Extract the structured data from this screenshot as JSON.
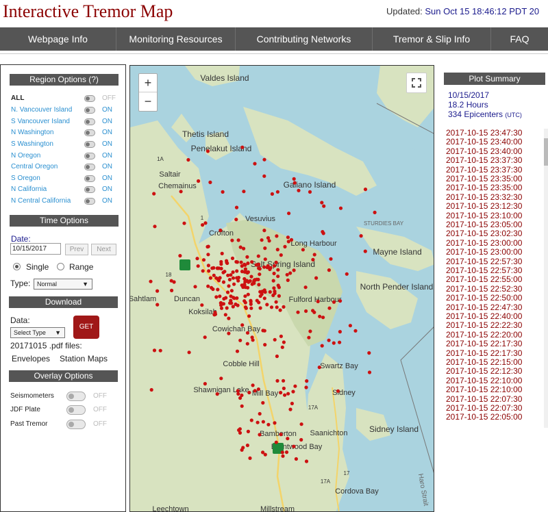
{
  "header": {
    "title": "Interactive Tremor Map",
    "updated_label": "Updated:",
    "updated_value": "Sun Oct 15 18:46:12 PDT 20"
  },
  "nav": [
    "Webpage Info",
    "Monitoring Resources",
    "Contributing Networks",
    "Tremor & Slip Info",
    "FAQ"
  ],
  "region": {
    "heading": "Region Options (?)",
    "items": [
      {
        "name": "ALL",
        "state": "OFF"
      },
      {
        "name": "N. Vancouver Island",
        "state": "ON"
      },
      {
        "name": "S Vancouver Island",
        "state": "ON"
      },
      {
        "name": "N Washington",
        "state": "ON"
      },
      {
        "name": "S Washington",
        "state": "ON"
      },
      {
        "name": "N Oregon",
        "state": "ON"
      },
      {
        "name": "Central Oregon",
        "state": "ON"
      },
      {
        "name": "S Oregon",
        "state": "ON"
      },
      {
        "name": "N California",
        "state": "ON"
      },
      {
        "name": "N Central California",
        "state": "ON"
      }
    ]
  },
  "time": {
    "heading": "Time Options",
    "date_label": "Date:",
    "date_value": "10/15/2017",
    "prev": "Prev",
    "next": "Next",
    "single": "Single",
    "range": "Range",
    "type_label": "Type:",
    "type_value": "Normal"
  },
  "download": {
    "heading": "Download",
    "data_label": "Data:",
    "select_value": "Select Type",
    "get": "GET",
    "files_text": "20171015 .pdf files:",
    "envelopes": "Envelopes",
    "station_maps": "Station Maps"
  },
  "overlay": {
    "heading": "Overlay Options",
    "items": [
      {
        "name": "Seismometers",
        "state": "OFF"
      },
      {
        "name": "JDF Plate",
        "state": "OFF"
      },
      {
        "name": "Past Tremor",
        "state": "OFF"
      }
    ]
  },
  "map": {
    "zoom_in": "+",
    "zoom_out": "−",
    "labels": [
      "Valdes Island",
      "Thetis Island",
      "Penelakut Island",
      "Saltair",
      "Chemainus",
      "Galiano Island",
      "Vesuvius",
      "Crofton",
      "Long Harbour",
      "STURDIES BAY",
      "Mayne Island",
      "Salt Spring Island",
      "North Pender Island",
      "Duncan",
      "Sahtlam",
      "Fulford Harbour",
      "Koksilah",
      "Cowichan Bay",
      "Cobble Hill",
      "Swartz Bay",
      "Shawnigan Lake",
      "Mill Bay",
      "Sidney",
      "Bamberton",
      "Saanichton",
      "Sidney Island",
      "Brentwood Bay",
      "Cordova Bay",
      "Leechtown",
      "Millstream",
      "Haro Strait",
      "1A",
      "1",
      "18",
      "17A",
      "17",
      "17A",
      "1"
    ]
  },
  "summary": {
    "heading": "Plot Summary",
    "date": "10/15/2017",
    "hours": "18.2 Hours",
    "epicenters": "334 Epicenters",
    "utc": "(UTC)",
    "timestamps": [
      "2017-10-15 23:47:30",
      "2017-10-15 23:40:00",
      "2017-10-15 23:40:00",
      "2017-10-15 23:37:30",
      "2017-10-15 23:37:30",
      "2017-10-15 23:35:00",
      "2017-10-15 23:35:00",
      "2017-10-15 23:32:30",
      "2017-10-15 23:12:30",
      "2017-10-15 23:10:00",
      "2017-10-15 23:05:00",
      "2017-10-15 23:02:30",
      "2017-10-15 23:00:00",
      "2017-10-15 23:00:00",
      "2017-10-15 22:57:30",
      "2017-10-15 22:57:30",
      "2017-10-15 22:55:00",
      "2017-10-15 22:52:30",
      "2017-10-15 22:50:00",
      "2017-10-15 22:47:30",
      "2017-10-15 22:40:00",
      "2017-10-15 22:22:30",
      "2017-10-15 22:20:00",
      "2017-10-15 22:17:30",
      "2017-10-15 22:17:30",
      "2017-10-15 22:15:00",
      "2017-10-15 22:12:30",
      "2017-10-15 22:10:00",
      "2017-10-15 22:10:00",
      "2017-10-15 22:07:30",
      "2017-10-15 22:07:30",
      "2017-10-15 22:05:00"
    ]
  },
  "colors": {
    "accent": "#8b0000",
    "nav_bg": "#555555",
    "water": "#aad3df",
    "land": "#d8e3c0",
    "marker": "#cc1111"
  }
}
